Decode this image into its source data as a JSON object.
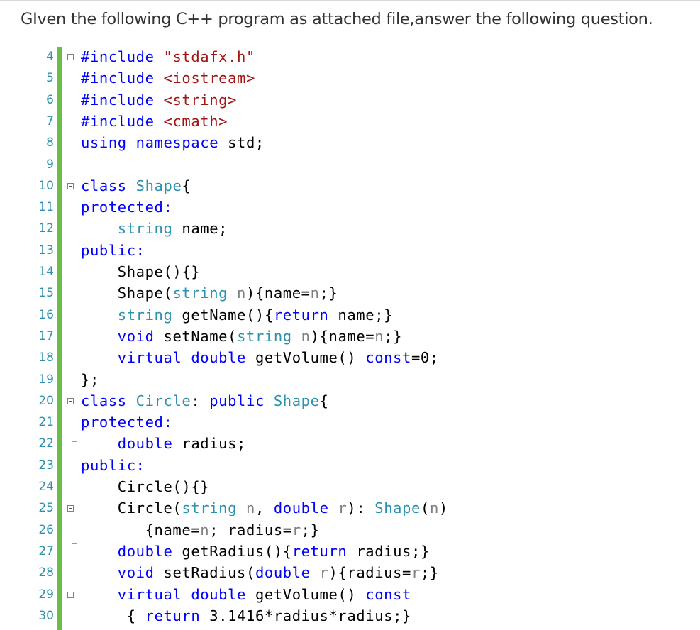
{
  "question": "GIven the following C++ program as attached file,answer the following question.",
  "lines": [
    {
      "n": "4",
      "text": "#include \"stdafx.h\""
    },
    {
      "n": "5",
      "text": "#include <iostream>"
    },
    {
      "n": "6",
      "text": "#include <string>"
    },
    {
      "n": "7",
      "text": "#include <cmath>"
    },
    {
      "n": "8",
      "text": "using namespace std;"
    },
    {
      "n": "9",
      "text": ""
    },
    {
      "n": "10",
      "text": "class Shape{"
    },
    {
      "n": "11",
      "text": "protected:"
    },
    {
      "n": "12",
      "text": "    string name;"
    },
    {
      "n": "13",
      "text": "public:"
    },
    {
      "n": "14",
      "text": "    Shape(){}"
    },
    {
      "n": "15",
      "text": "    Shape(string n){name=n;}"
    },
    {
      "n": "16",
      "text": "    string getName(){return name;}"
    },
    {
      "n": "17",
      "text": "    void setName(string n){name=n;}"
    },
    {
      "n": "18",
      "text": "    virtual double getVolume() const=0;"
    },
    {
      "n": "19",
      "text": "};"
    },
    {
      "n": "20",
      "text": "class Circle: public Shape{"
    },
    {
      "n": "21",
      "text": "protected:"
    },
    {
      "n": "22",
      "text": "    double radius;"
    },
    {
      "n": "23",
      "text": "public:"
    },
    {
      "n": "24",
      "text": "    Circle(){}"
    },
    {
      "n": "25",
      "text": "    Circle(string n, double r): Shape(n)"
    },
    {
      "n": "26",
      "text": "       {name=n; radius=r;}"
    },
    {
      "n": "27",
      "text": "    double getRadius(){return radius;}"
    },
    {
      "n": "28",
      "text": "    void setRadius(double r){radius=r;}"
    },
    {
      "n": "29",
      "text": "    virtual double getVolume() const"
    },
    {
      "n": "30",
      "text": "     { return 3.1416*radius*radius;}"
    }
  ]
}
